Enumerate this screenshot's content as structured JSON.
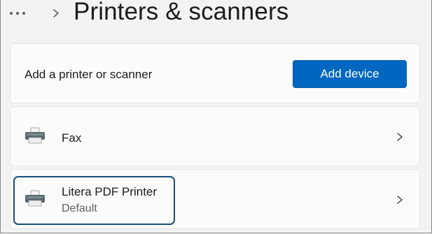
{
  "header": {
    "more_icon": "more-horizontal-icon",
    "separator_icon": "chevron-right-icon",
    "title": "Printers & scanners"
  },
  "add_section": {
    "label": "Add a printer or scanner",
    "button_label": "Add device",
    "accent_color": "#0067c0"
  },
  "devices": [
    {
      "icon": "printer-icon",
      "name": "Fax",
      "status": "",
      "chevron_icon": "chevron-right-icon",
      "focused": false
    },
    {
      "icon": "printer-icon",
      "name": "Litera PDF Printer",
      "status": "Default",
      "chevron_icon": "chevron-right-icon",
      "focused": true
    }
  ],
  "colors": {
    "background": "#f3f3f3",
    "card": "#fbfbfb",
    "focus_ring": "#1a4f78"
  }
}
